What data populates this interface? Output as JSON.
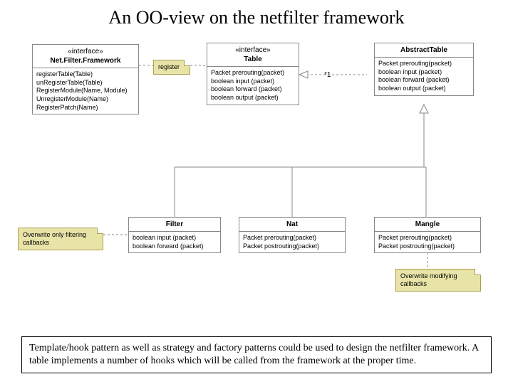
{
  "title": "An OO-view on the netfilter framework",
  "boxes": {
    "framework": {
      "stereo": "«interface»",
      "name": "Net.Filter.Framework",
      "ops": [
        "registerTable(Table)",
        "unRegisterTable(Table)",
        "RegisterModule(Name, Module)",
        "UnregisterModule(Name)",
        "RegisterPatch(Name)"
      ]
    },
    "table": {
      "stereo": "«interface»",
      "name": "Table",
      "ops": [
        "Packet prerouting(packet)",
        "boolean input (packet)",
        "boolean forward (packet)",
        "boolean output (packet)"
      ]
    },
    "abstract": {
      "name": "AbstractTable",
      "ops": [
        "Packet prerouting(packet)",
        "boolean input (packet)",
        "boolean forward (packet)",
        "boolean output (packet)"
      ]
    },
    "filter": {
      "name": "Filter",
      "ops": [
        "boolean input (packet)",
        "boolean forward (packet)"
      ]
    },
    "nat": {
      "name": "Nat",
      "ops": [
        "Packet prerouting(packet)",
        "Packet postrouting(packet)"
      ]
    },
    "mangle": {
      "name": "Mangle",
      "ops": [
        "Packet prerouting(packet)",
        "Packet postrouting(packet)"
      ]
    }
  },
  "notes": {
    "register": "register",
    "filterNote": "Overwrite only filtering callbacks",
    "mangleNote": "Overwrite modifying callbacks"
  },
  "relLabel": "*1",
  "footer": "Template/hook pattern as well as strategy and factory patterns could be used to design the netfilter framework. A table implements a number of hooks which will be called from the framework at the proper time."
}
